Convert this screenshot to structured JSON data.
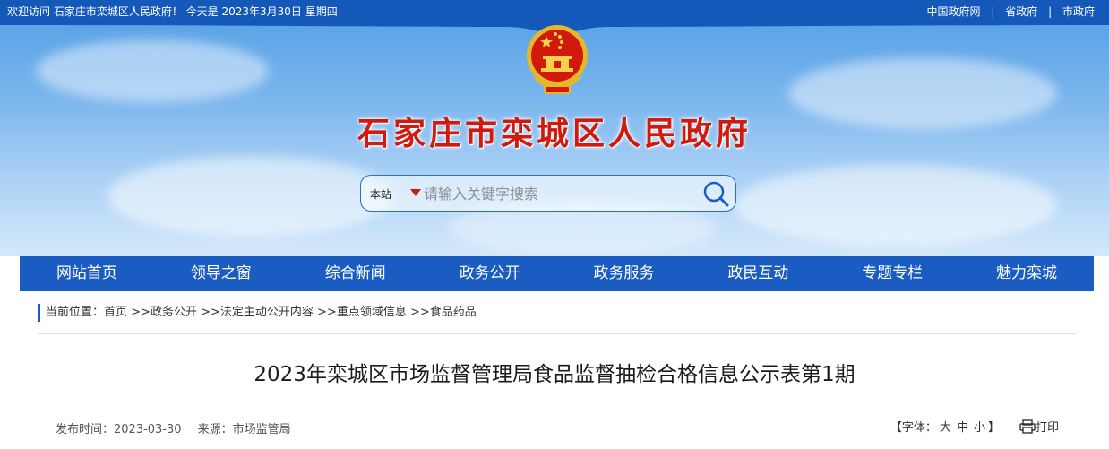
{
  "topbar": {
    "welcome": "欢迎访问 石家庄市栾城区人民政府！ 今天是  2023年3月30日 星期四",
    "links": [
      "中国政府网",
      "省政府",
      "市政府"
    ],
    "separator": "|"
  },
  "header": {
    "site_title": "石家庄市栾城区人民政府",
    "emblem_icon": "national-emblem-icon"
  },
  "search": {
    "scope": "本站",
    "placeholder": "请输入关键字搜索",
    "value": ""
  },
  "nav": {
    "items": [
      "网站首页",
      "领导之窗",
      "综合新闻",
      "政务公开",
      "政务服务",
      "政民互动",
      "专题专栏",
      "魅力栾城"
    ]
  },
  "breadcrumb": {
    "prefix": "当前位置：",
    "items": [
      "首页",
      "政务公开",
      "法定主动公开内容",
      "重点领域信息",
      "食品药品"
    ],
    "separator": " >>"
  },
  "article": {
    "title": "2023年栾城区市场监督管理局食品监督抽检合格信息公示表第1期",
    "published_label": "发布时间：",
    "published_date": "2023-03-30",
    "source_label": "来源：",
    "source": "市场监管局"
  },
  "tools": {
    "open_bracket": "【字体：",
    "font_large": "大",
    "font_medium": "中",
    "font_small": "小",
    "close_bracket": "】",
    "print_label": "打印"
  },
  "colors": {
    "brand_blue": "#1a5cc1",
    "title_red": "#d11a0d"
  }
}
